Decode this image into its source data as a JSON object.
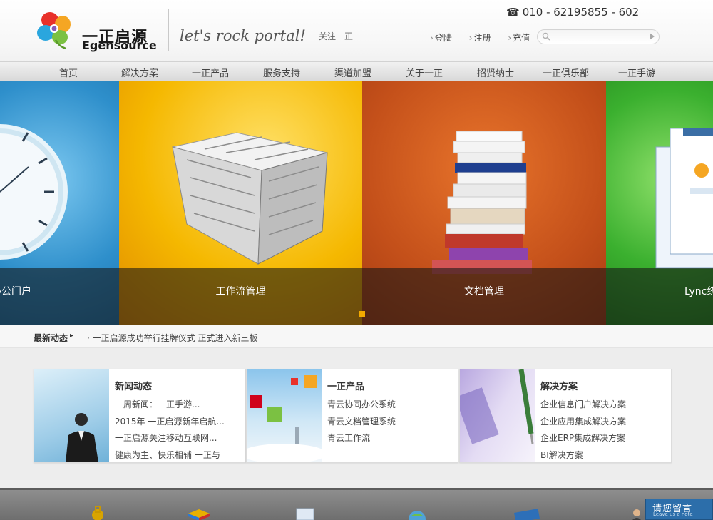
{
  "header": {
    "logo_cn": "一正启源",
    "logo_en": "Egensource",
    "slogan": "let's rock portal!",
    "follow": "关注一正",
    "phone": "010 - 62195855 - 602",
    "links": {
      "login": "登陆",
      "register": "注册",
      "recharge": "充值"
    },
    "search_placeholder": ""
  },
  "nav": {
    "items": [
      "首页",
      "解决方案",
      "一正产品",
      "服务支持",
      "渠道加盟",
      "关于一正",
      "招贤纳士",
      "一正俱乐部",
      "一正手游"
    ]
  },
  "banner": {
    "slides": [
      {
        "caption": "办公门户",
        "color": "#3a9fd6"
      },
      {
        "caption": "工作流管理",
        "color": "#f0b400"
      },
      {
        "caption": "文档管理",
        "color": "#c9561b"
      },
      {
        "caption": "Lync统",
        "color": "#3bb02f"
      }
    ],
    "active_dot_color": "#f2a900"
  },
  "ticker": {
    "label": "最新动态",
    "text": "· 一正启源成功举行挂牌仪式 正式进入新三板"
  },
  "panels": [
    {
      "title": "新闻动态",
      "items": [
        "一周新闻：一正手游...",
        "2015年 一正启源新年启航...",
        "一正启源关注移动互联网...",
        "健康为主、快乐相辅 一正与"
      ]
    },
    {
      "title": "一正产品",
      "items": [
        "青云协同办公系统",
        "青云文档管理系统",
        "青云工作流"
      ]
    },
    {
      "title": "解决方案",
      "items": [
        "企业信息门户解决方案",
        "企业应用集成解决方案",
        "企业ERP集成解决方案",
        "BI解决方案"
      ]
    }
  ],
  "footer": {
    "message_cn": "请您留言",
    "message_en": "Leave us a note",
    "icons": [
      "lock-icon",
      "rubik-cube-icon",
      "monitor-icon",
      "globe-icon",
      "card-icon",
      "person-icon"
    ]
  }
}
